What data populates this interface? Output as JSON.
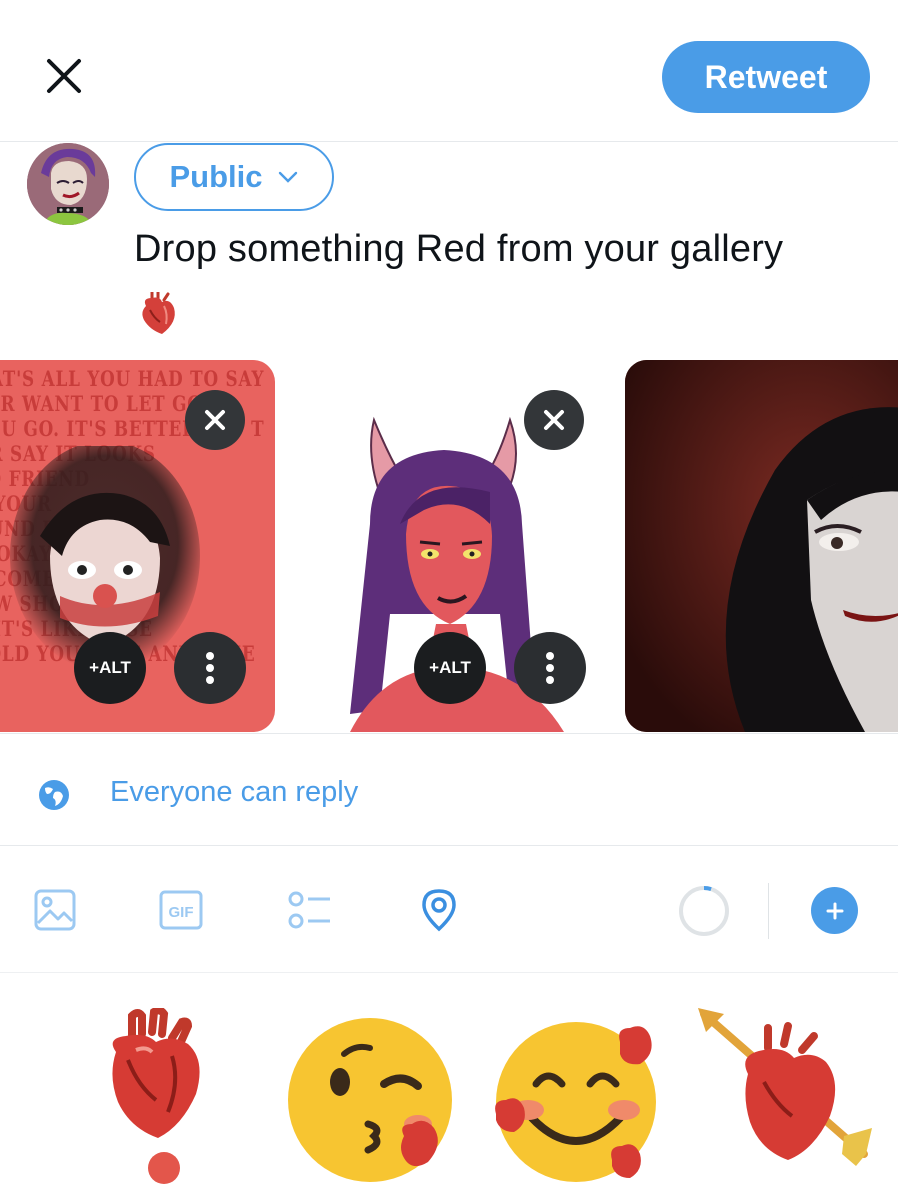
{
  "header": {
    "close_icon": "close-icon",
    "retweet_label": "Retweet"
  },
  "composer": {
    "audience_label": "Public",
    "audience_chevron": "chevron-down-icon",
    "text": "Drop something Red from your gallery",
    "inline_emoji": "anatomical-heart"
  },
  "media": {
    "card1_wall_lines": [
      "HAT'S ALL YOU HAD TO SAY",
      "VER WANT TO LET GO",
      "YOU GO. IT'S BETTER OFF T",
      "OR SAY IT LOOKS",
      "TO FRIEND",
      "E YOUR",
      "OUND F",
      "N OKAY I'",
      "T COME OUT",
      "T W SHOW",
      "T IT'S LIKE IT SE",
      "TOLD YOU TIME AND TIME"
    ],
    "alt_label": "+ALT",
    "remove_icon": "close-icon",
    "more_icon": "more-vertical-icon"
  },
  "reply_settings": {
    "icon": "globe-icon",
    "label": "Everyone can reply"
  },
  "toolbar": {
    "tools": [
      "image-icon",
      "gif-icon",
      "poll-icon",
      "location-icon"
    ],
    "gif_text": "GIF",
    "character_progress": 0.05,
    "add_icon": "plus-icon"
  },
  "stickers": [
    "anatomical-heart-exclamation",
    "kissing-face-with-heart",
    "smiling-face-with-hearts",
    "heart-with-arrow"
  ],
  "colors": {
    "accent": "#4a9ce7",
    "card1_bg": "#e8635f",
    "card3_bg": "#5a1a17",
    "text": "#0f1419"
  }
}
